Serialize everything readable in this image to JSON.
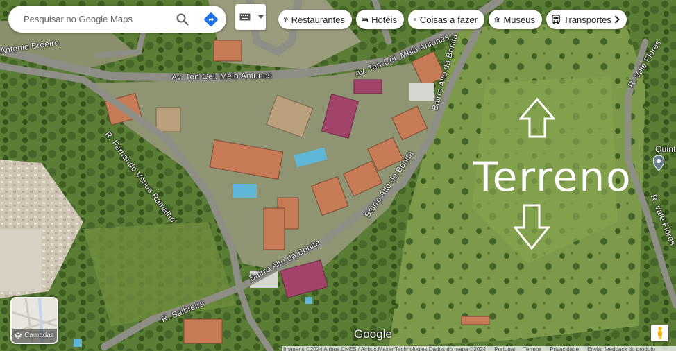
{
  "search": {
    "placeholder": "Pesquisar no Google Maps",
    "icon": "search-icon",
    "directions_icon": "directions-icon"
  },
  "chips": [
    {
      "label": "Restaurantes",
      "icon": "fork-knife-icon"
    },
    {
      "label": "Hotéis",
      "icon": "bed-icon"
    },
    {
      "label": "Coisas a fazer",
      "icon": "camera-icon"
    },
    {
      "label": "Museus",
      "icon": "museum-icon"
    },
    {
      "label": "Transportes",
      "icon": "bus-icon"
    }
  ],
  "streets": {
    "antonio_broeiro": "António Broeiro",
    "melo_antunes_main": "Av. Ten-Cel. Melo Antunes",
    "melo_antunes_upper": "Av. Ten-Cel. Melo Antunes",
    "fernando_venus": "R. Fernando Vénus Ramalho",
    "bairro_upper": "Bairro Alto da Bonita",
    "bairro_mid": "Bairro Alto da Bonita",
    "bairro_lower": "Bairro Alto da Bonita",
    "saibreira": "R. Saibreira",
    "vale_flores_upper": "R. Vale Flores",
    "vale_flores_lower": "R. Vale Flores",
    "quinta": "Quinta"
  },
  "annotation": {
    "text": "Terreno"
  },
  "layers": {
    "label": "Camadas"
  },
  "branding": {
    "logo": "Google"
  },
  "attribution": {
    "imagery": "Imagens ©2024 Airbus,CNES / Airbus,Maxar Technologies,Dados do mapa ©2024",
    "country": "Portugal",
    "terms": "Termos",
    "privacy": "Privacidade",
    "feedback": "Enviar feedback do produto"
  },
  "colors": {
    "accent": "#1a73e8",
    "terrain": "#6b8a43",
    "road": "#8d8d86"
  }
}
